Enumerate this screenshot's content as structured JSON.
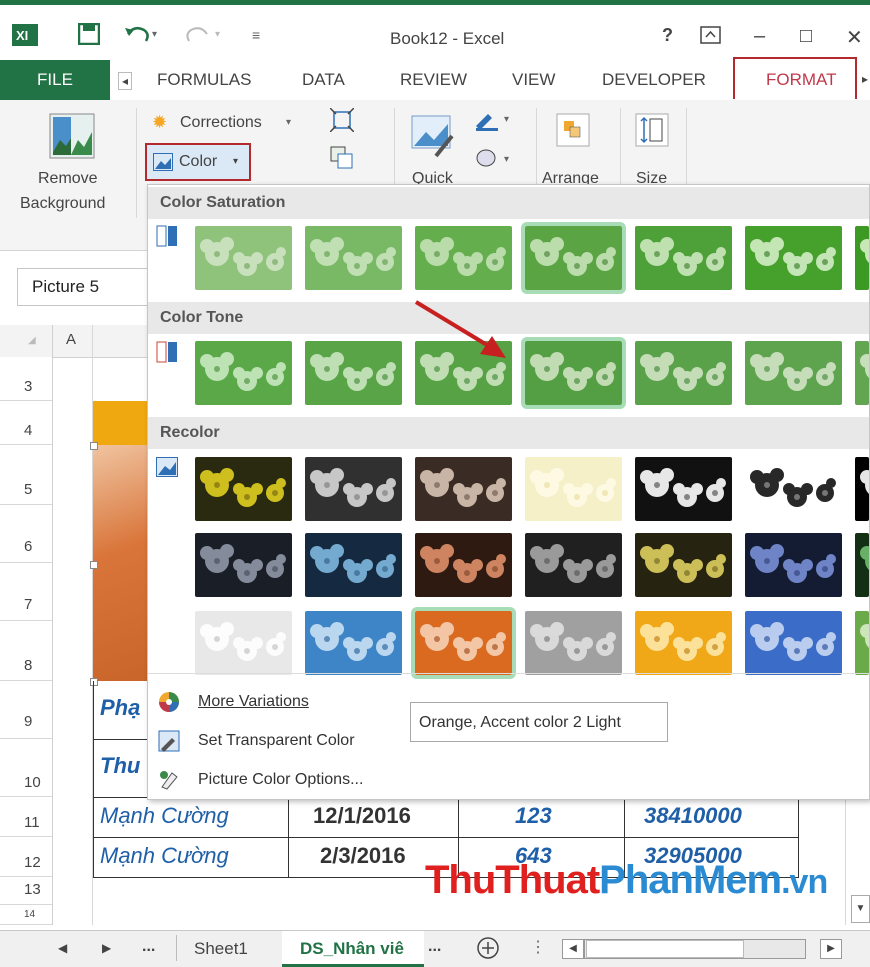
{
  "window": {
    "title": "Book12 - Excel",
    "help": "?",
    "minimize": "–",
    "maximize": "□",
    "close": "✕"
  },
  "tabs": {
    "file": "FILE",
    "items": [
      "FORMULAS",
      "DATA",
      "REVIEW",
      "VIEW",
      "DEVELOPER"
    ],
    "format": "FORMAT"
  },
  "ribbon": {
    "remove_background": [
      "Remove",
      "Background"
    ],
    "corrections": "Corrections",
    "color": "Color",
    "quick": "Quick",
    "arrange": "Arrange",
    "size": "Size"
  },
  "namebox": "Picture 5",
  "col_headers": [
    "A"
  ],
  "row_numbers": [
    "3",
    "4",
    "5",
    "6",
    "7",
    "8",
    "9",
    "10",
    "11",
    "12",
    "13",
    "14"
  ],
  "cells": {
    "r9_a": "Phạ",
    "r10_a": "Thu",
    "r11": {
      "name": "Mạnh Cường",
      "date": "12/1/2016",
      "qty": "123",
      "amount": "38410000"
    },
    "r12": {
      "name": "Mạnh Cường",
      "date": "2/3/2016",
      "qty": "643",
      "amount": "32905000"
    }
  },
  "dropdown": {
    "sections": [
      "Color Saturation",
      "Color Tone",
      "Recolor"
    ],
    "menu": [
      {
        "label": "More Variations",
        "icon": "palette-icon"
      },
      {
        "label": "Set Transparent Color",
        "icon": "transparent-color-icon"
      },
      {
        "label": "Picture Color Options...",
        "icon": "color-options-icon"
      }
    ],
    "tooltip": "Orange, Accent color 2 Light"
  },
  "sheets": {
    "nav_more": "...",
    "sheet1": "Sheet1",
    "sheet2": "DS_Nhân viê",
    "more": "..."
  },
  "watermark": {
    "part1": "ThuThuat",
    "part2": "PhanMem",
    "part3": ".vn"
  },
  "colors": {
    "excel_green": "#217346",
    "highlight_red": "#b3292e",
    "selection_green": "#a8dcb6"
  }
}
